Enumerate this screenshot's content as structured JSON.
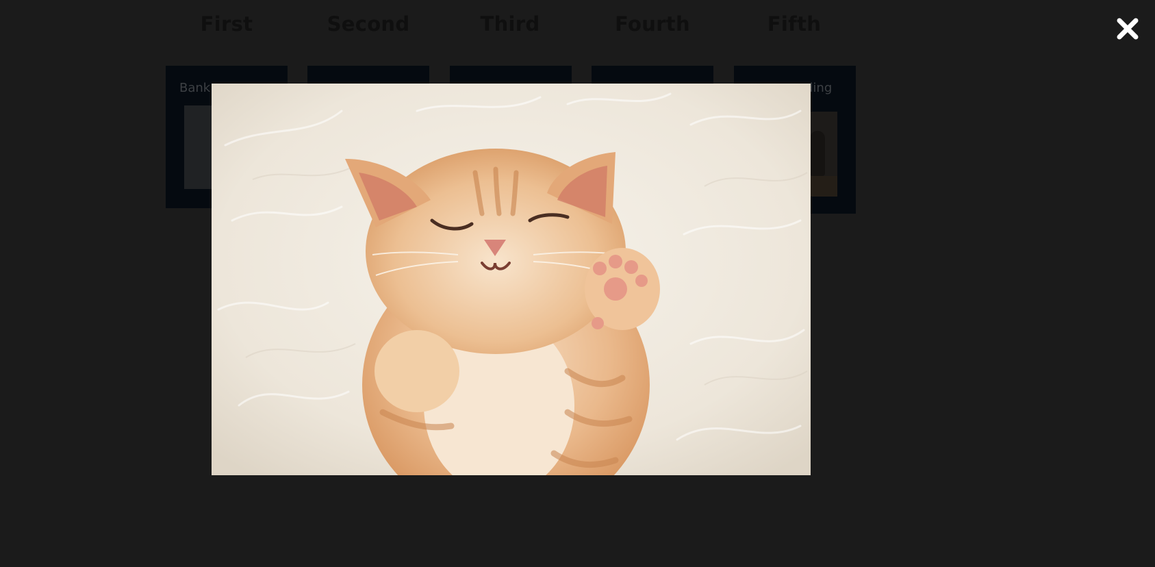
{
  "columns": [
    {
      "title": "First"
    },
    {
      "title": "Second"
    },
    {
      "title": "Third"
    },
    {
      "title": "Fourth"
    },
    {
      "title": "Fifth"
    }
  ],
  "cards": {
    "first_label_visible": "Bank",
    "fifth_label_visible": "ding"
  },
  "lightbox": {
    "image_subject": "sleeping-kitten-photo",
    "close_icon": "close-icon"
  },
  "colors": {
    "backdrop": "#1b1b1b",
    "close_icon": "#ffffff"
  }
}
